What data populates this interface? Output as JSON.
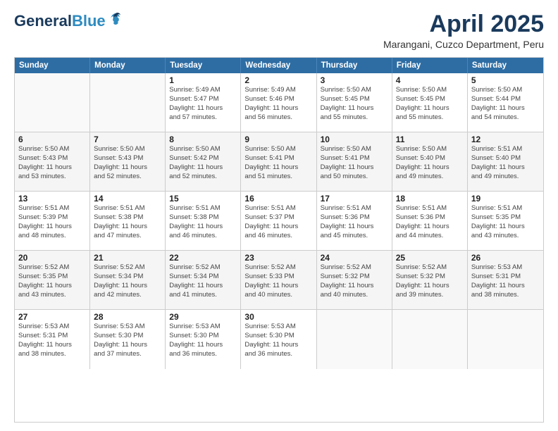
{
  "header": {
    "logo_general": "General",
    "logo_blue": "Blue",
    "month_title": "April 2025",
    "location": "Marangani, Cuzco Department, Peru"
  },
  "days_of_week": [
    "Sunday",
    "Monday",
    "Tuesday",
    "Wednesday",
    "Thursday",
    "Friday",
    "Saturday"
  ],
  "weeks": [
    [
      {
        "day": "",
        "info": ""
      },
      {
        "day": "",
        "info": ""
      },
      {
        "day": "1",
        "info": "Sunrise: 5:49 AM\nSunset: 5:47 PM\nDaylight: 11 hours\nand 57 minutes."
      },
      {
        "day": "2",
        "info": "Sunrise: 5:49 AM\nSunset: 5:46 PM\nDaylight: 11 hours\nand 56 minutes."
      },
      {
        "day": "3",
        "info": "Sunrise: 5:50 AM\nSunset: 5:45 PM\nDaylight: 11 hours\nand 55 minutes."
      },
      {
        "day": "4",
        "info": "Sunrise: 5:50 AM\nSunset: 5:45 PM\nDaylight: 11 hours\nand 55 minutes."
      },
      {
        "day": "5",
        "info": "Sunrise: 5:50 AM\nSunset: 5:44 PM\nDaylight: 11 hours\nand 54 minutes."
      }
    ],
    [
      {
        "day": "6",
        "info": "Sunrise: 5:50 AM\nSunset: 5:43 PM\nDaylight: 11 hours\nand 53 minutes."
      },
      {
        "day": "7",
        "info": "Sunrise: 5:50 AM\nSunset: 5:43 PM\nDaylight: 11 hours\nand 52 minutes."
      },
      {
        "day": "8",
        "info": "Sunrise: 5:50 AM\nSunset: 5:42 PM\nDaylight: 11 hours\nand 52 minutes."
      },
      {
        "day": "9",
        "info": "Sunrise: 5:50 AM\nSunset: 5:41 PM\nDaylight: 11 hours\nand 51 minutes."
      },
      {
        "day": "10",
        "info": "Sunrise: 5:50 AM\nSunset: 5:41 PM\nDaylight: 11 hours\nand 50 minutes."
      },
      {
        "day": "11",
        "info": "Sunrise: 5:50 AM\nSunset: 5:40 PM\nDaylight: 11 hours\nand 49 minutes."
      },
      {
        "day": "12",
        "info": "Sunrise: 5:51 AM\nSunset: 5:40 PM\nDaylight: 11 hours\nand 49 minutes."
      }
    ],
    [
      {
        "day": "13",
        "info": "Sunrise: 5:51 AM\nSunset: 5:39 PM\nDaylight: 11 hours\nand 48 minutes."
      },
      {
        "day": "14",
        "info": "Sunrise: 5:51 AM\nSunset: 5:38 PM\nDaylight: 11 hours\nand 47 minutes."
      },
      {
        "day": "15",
        "info": "Sunrise: 5:51 AM\nSunset: 5:38 PM\nDaylight: 11 hours\nand 46 minutes."
      },
      {
        "day": "16",
        "info": "Sunrise: 5:51 AM\nSunset: 5:37 PM\nDaylight: 11 hours\nand 46 minutes."
      },
      {
        "day": "17",
        "info": "Sunrise: 5:51 AM\nSunset: 5:36 PM\nDaylight: 11 hours\nand 45 minutes."
      },
      {
        "day": "18",
        "info": "Sunrise: 5:51 AM\nSunset: 5:36 PM\nDaylight: 11 hours\nand 44 minutes."
      },
      {
        "day": "19",
        "info": "Sunrise: 5:51 AM\nSunset: 5:35 PM\nDaylight: 11 hours\nand 43 minutes."
      }
    ],
    [
      {
        "day": "20",
        "info": "Sunrise: 5:52 AM\nSunset: 5:35 PM\nDaylight: 11 hours\nand 43 minutes."
      },
      {
        "day": "21",
        "info": "Sunrise: 5:52 AM\nSunset: 5:34 PM\nDaylight: 11 hours\nand 42 minutes."
      },
      {
        "day": "22",
        "info": "Sunrise: 5:52 AM\nSunset: 5:34 PM\nDaylight: 11 hours\nand 41 minutes."
      },
      {
        "day": "23",
        "info": "Sunrise: 5:52 AM\nSunset: 5:33 PM\nDaylight: 11 hours\nand 40 minutes."
      },
      {
        "day": "24",
        "info": "Sunrise: 5:52 AM\nSunset: 5:32 PM\nDaylight: 11 hours\nand 40 minutes."
      },
      {
        "day": "25",
        "info": "Sunrise: 5:52 AM\nSunset: 5:32 PM\nDaylight: 11 hours\nand 39 minutes."
      },
      {
        "day": "26",
        "info": "Sunrise: 5:53 AM\nSunset: 5:31 PM\nDaylight: 11 hours\nand 38 minutes."
      }
    ],
    [
      {
        "day": "27",
        "info": "Sunrise: 5:53 AM\nSunset: 5:31 PM\nDaylight: 11 hours\nand 38 minutes."
      },
      {
        "day": "28",
        "info": "Sunrise: 5:53 AM\nSunset: 5:30 PM\nDaylight: 11 hours\nand 37 minutes."
      },
      {
        "day": "29",
        "info": "Sunrise: 5:53 AM\nSunset: 5:30 PM\nDaylight: 11 hours\nand 36 minutes."
      },
      {
        "day": "30",
        "info": "Sunrise: 5:53 AM\nSunset: 5:30 PM\nDaylight: 11 hours\nand 36 minutes."
      },
      {
        "day": "",
        "info": ""
      },
      {
        "day": "",
        "info": ""
      },
      {
        "day": "",
        "info": ""
      }
    ]
  ]
}
